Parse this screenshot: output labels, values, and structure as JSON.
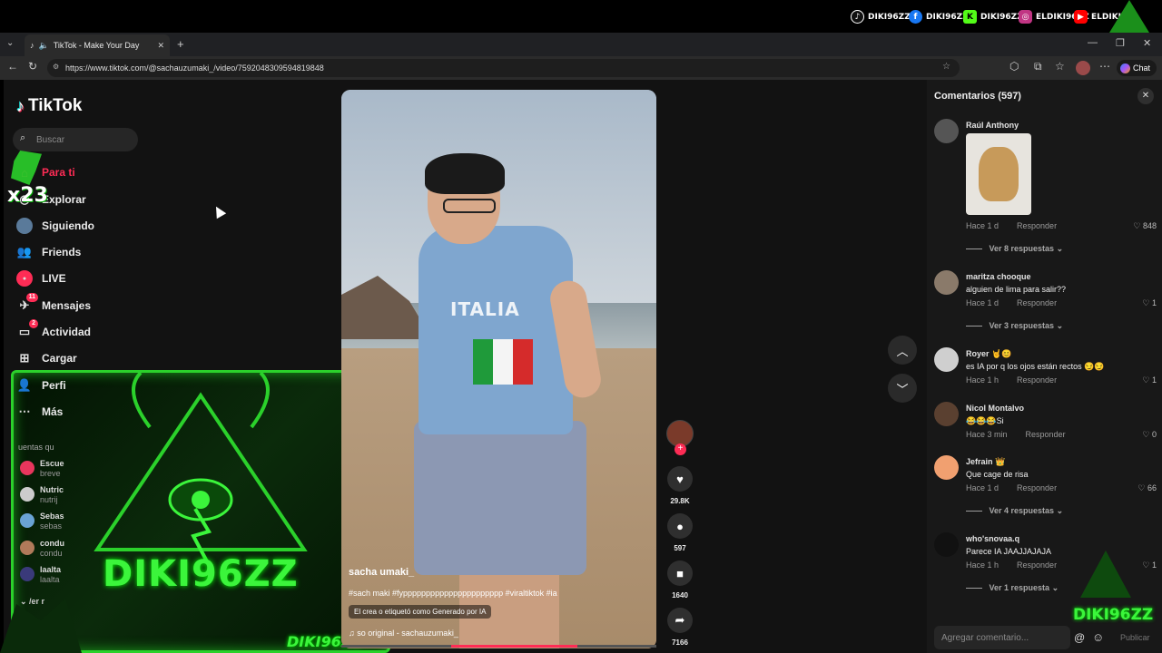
{
  "stream_bar": {
    "socials": [
      {
        "icon": "tiktok-icon",
        "label": "DIKI96ZZ",
        "color": "#000000"
      },
      {
        "icon": "facebook-icon",
        "label": "DIKI96ZZ",
        "color": "#1877f2"
      },
      {
        "icon": "kick-icon",
        "label": "DIKI96ZZ",
        "color": "#53fc18"
      },
      {
        "icon": "instagram-icon",
        "label": "ELDIKI96ZZ",
        "color": "#c13584"
      },
      {
        "icon": "youtube-icon",
        "label": "ELDIKI",
        "color": "#ff0000"
      }
    ]
  },
  "browser": {
    "tab_title": "TikTok - Make Your Day",
    "url": "https://www.tiktok.com/@sachauzumaki_/video/7592048309594819848",
    "copilot_label": "Chat"
  },
  "sidebar": {
    "brand": "TikTok",
    "search_placeholder": "Buscar",
    "items": [
      {
        "label": "Para ti",
        "icon": "home-icon",
        "active": true
      },
      {
        "label": "Explorar",
        "icon": "compass-icon"
      },
      {
        "label": "Siguiendo",
        "icon": "following-avatar-icon"
      },
      {
        "label": "Friends",
        "icon": "friends-icon"
      },
      {
        "label": "LIVE",
        "icon": "live-icon"
      },
      {
        "label": "Mensajes",
        "icon": "messages-icon",
        "badge": "11"
      },
      {
        "label": "Actividad",
        "icon": "activity-icon",
        "badge": "2"
      },
      {
        "label": "Cargar",
        "icon": "upload-icon"
      },
      {
        "label": "Perfi",
        "icon": "profile-icon"
      },
      {
        "label": "Más",
        "icon": "more-icon"
      }
    ],
    "suggested_header": "uentas qu",
    "suggested": [
      {
        "name": "Escue",
        "sub": "breve",
        "color": "#e8365d"
      },
      {
        "name": "Nutric",
        "sub": "nutrij",
        "color": "#cccccc"
      },
      {
        "name": "Sebas",
        "sub": "sebas",
        "color": "#6aa3d5"
      },
      {
        "name": "condu",
        "sub": "condu",
        "color": "#b07a5a"
      },
      {
        "name": "laalta",
        "sub": "laalta",
        "color": "#3a3a7a"
      }
    ],
    "see_more": "/er r",
    "overlay_tag": "x23"
  },
  "video": {
    "shirt_text": "ITALIA",
    "author": "sacha      umaki_",
    "tags": "#sach      maki #fypppppppppppppppppppppp #viraltiktok #ia",
    "ai_label": "El crea      o etiquetó como Generado por IA",
    "music": "so      original - sachauzumaki_"
  },
  "actions": [
    {
      "icon": "heart-icon",
      "glyph": "♥",
      "count": "29.8K"
    },
    {
      "icon": "comment-icon",
      "glyph": "●",
      "count": "597"
    },
    {
      "icon": "bookmark-icon",
      "glyph": "■",
      "count": "1640"
    },
    {
      "icon": "share-icon",
      "glyph": "➦",
      "count": "7166"
    }
  ],
  "comments_panel": {
    "title": "Comentarios (597)",
    "input_placeholder": "Agregar comentario...",
    "post_label": "Publicar",
    "items": [
      {
        "name": "Raúl Anthony",
        "text": "",
        "time": "Hace 1 d",
        "reply": "Responder",
        "likes": "848",
        "more": "Ver 8 respuestas",
        "avatar": "#555555"
      },
      {
        "name": "maritza chooque",
        "text": "alguien de lima para salir??",
        "time": "Hace 1 d",
        "reply": "Responder",
        "likes": "1",
        "more": "Ver 3 respuestas",
        "avatar": "#8a7a6a"
      },
      {
        "name": "Royer 🤘😊",
        "text": "es IA por q los ojos están rectos 😏😏",
        "time": "Hace 1 h",
        "reply": "Responder",
        "likes": "1",
        "more": "",
        "avatar": "#cfcfcf"
      },
      {
        "name": "Nicol Montalvo",
        "text": "😂😂😂Si",
        "time": "Hace 3 min",
        "reply": "Responder",
        "likes": "0",
        "more": "",
        "avatar": "#5a4030"
      },
      {
        "name": "Jefrain 👑",
        "text": "Que cage de risa",
        "time": "Hace 1 d",
        "reply": "Responder",
        "likes": "66",
        "more": "Ver 4 respuestas",
        "avatar": "#f1a070"
      },
      {
        "name": "who'snovaa.q",
        "text": "Parece IA JAAJJAJAJA",
        "time": "Hace 1 h",
        "reply": "Responder",
        "likes": "1",
        "more": "Ver 1 respuesta",
        "avatar": "#111111"
      }
    ]
  },
  "overlays": {
    "cam_logo": "DIKI96ZZ",
    "cam_name": "DIKI96ZZ",
    "watermark": "DIKI96ZZ"
  }
}
